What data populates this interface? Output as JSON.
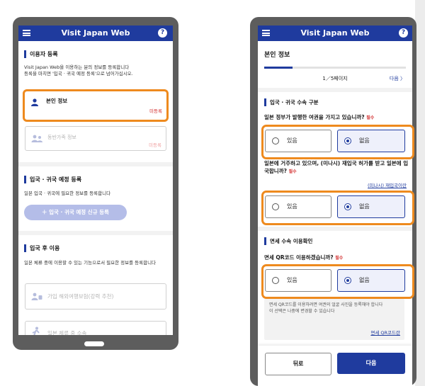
{
  "app": {
    "title": "Visit Japan Web",
    "help_glyph": "?"
  },
  "screen1": {
    "section1_title": "이용자 등록",
    "section1_desc": "Visit Japan Web을 이용하는 분의 정보를 등록합니다\n등록을 마치면 '입국 · 귀국 예정 등록'으로 넘어가십시오.",
    "card_personal_label": "본인 정보",
    "card_personal_status": "미등록",
    "card_family_label": "동반가족 정보",
    "card_family_status": "미등록",
    "section2_title": "입국 · 귀국 예정 등록",
    "section2_desc": "일본 입국 · 귀국에 필요한 정보를 등록합니다",
    "register_button": "＋  입국 · 귀국 예정 신규 등록",
    "section3_title": "입국 후 이용",
    "section3_desc": "일본 체류 중에 이용할 수 있는 기능으로서 필요한 정보를 등록합니다",
    "card_insurance_label": "가입 해외여행보험(강력 추천)",
    "card_stay_label": "일본 체류 중 수속"
  },
  "screen2": {
    "page_title": "본인 정보",
    "progress_fraction": 0.2,
    "page_indicator": "1／5페이지",
    "next_link": "다음 〉",
    "section1_title": "입국 · 귀국 수속 구분",
    "q1": "일본 정부가 발행한 여권을 가지고 있습니까?",
    "q2": "일본에 거주하고 있으며, (미나시) 재입국 허가를 받고 일본에 입국합니까?",
    "q2_link": "(미나시) 재입국이란",
    "section2_title": "면세 수속 이용확인",
    "q3": "면세 QR코드 이용하겠습니까?",
    "required": "필수",
    "option_yes": "있음",
    "option_no": "없음",
    "note": "면세 QR코드를 이용하려면 여권의 얼굴 사진을 등록해야 합니다\n이 선택은 나중에 변경할 수 있습니다",
    "note_link": "면세 QR코드란",
    "back_button": "뒤로",
    "next_button": "다음"
  },
  "colors": {
    "brand": "#1f3b9e",
    "highlight": "#ee8a1e",
    "required": "#d32f2f"
  }
}
